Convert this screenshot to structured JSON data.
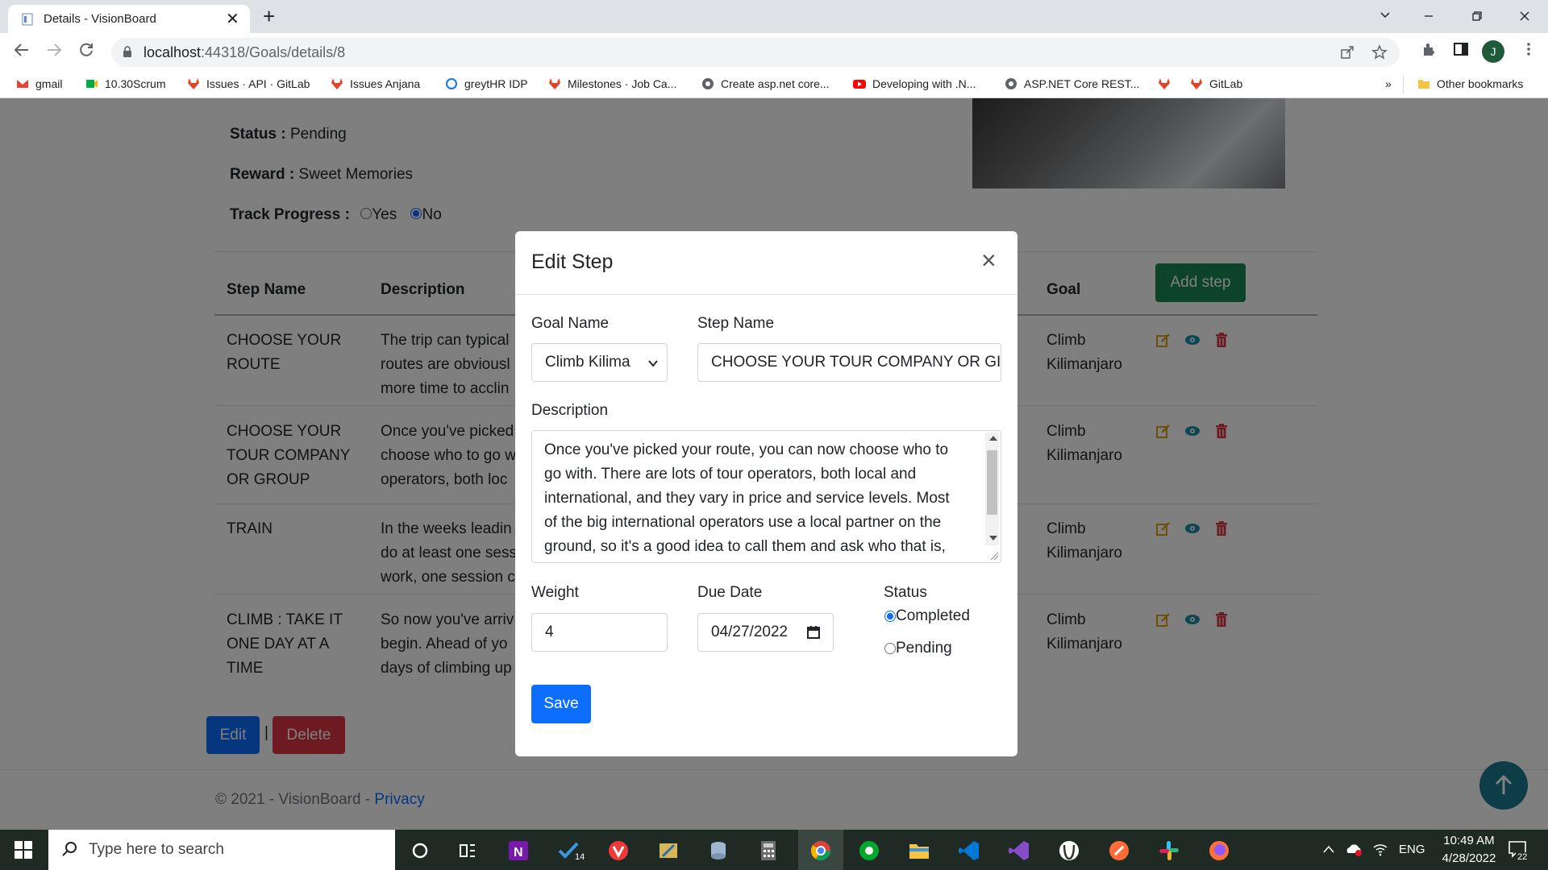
{
  "browser": {
    "tab_title": "Details - VisionBoard",
    "tab_close": "✕",
    "new_tab": "+",
    "url_host": "localhost",
    "url_rest": ":44318/Goals/details/8",
    "profile_initial": "J",
    "bookmarks": [
      "gmail",
      "10.30Scrum",
      "Issues · API · GitLab",
      "Issues Anjana",
      "greytHR IDP",
      "Milestones · Job Ca...",
      "Create asp.net core...",
      "Developing with .N...",
      "ASP.NET Core REST...",
      "",
      "GitLab"
    ],
    "bookmarks_more": "»",
    "other_bookmarks": "Other bookmarks"
  },
  "goal": {
    "status_label": "Status :",
    "status_value": "Pending",
    "reward_label": "Reward :",
    "reward_value": "Sweet Memories",
    "track_label": "Track Progress :",
    "track_yes": "Yes",
    "track_no": "No"
  },
  "table": {
    "headers": {
      "step_name": "Step Name",
      "description": "Description",
      "goal": "Goal"
    },
    "add_step": "Add step",
    "rows": [
      {
        "name": [
          "CHOOSE YOUR",
          "ROUTE"
        ],
        "desc": [
          "The trip can typical",
          "routes are obviousl",
          "more time to acclin"
        ],
        "goal": [
          "Climb",
          "Kilimanjaro"
        ]
      },
      {
        "name": [
          "CHOOSE YOUR",
          "TOUR COMPANY",
          "OR GROUP"
        ],
        "desc": [
          "Once you've picked",
          "choose who to go w",
          "operators, both loc"
        ],
        "goal": [
          "Climb",
          "Kilimanjaro"
        ]
      },
      {
        "name": [
          "TRAIN"
        ],
        "desc": [
          "In the weeks leadin",
          "do at least one sess",
          "work, one session c"
        ],
        "goal": [
          "Climb",
          "Kilimanjaro"
        ]
      },
      {
        "name": [
          "CLIMB : TAKE IT",
          "ONE DAY AT A",
          "TIME"
        ],
        "desc": [
          "So now you've arriv",
          "begin. Ahead of yo",
          "days of climbing up one of the world's highest..."
        ],
        "goal": [
          "Climb",
          "Kilimanjaro"
        ]
      }
    ]
  },
  "actions": {
    "edit": "Edit",
    "separator": "|",
    "delete": "Delete"
  },
  "footer": {
    "text": "© 2021 - VisionBoard - ",
    "privacy": "Privacy"
  },
  "modal": {
    "title": "Edit Step",
    "close": "×",
    "goal_name_label": "Goal Name",
    "goal_name_value": "Climb Kilima",
    "step_name_label": "Step Name",
    "step_name_value": "CHOOSE YOUR TOUR COMPANY OR GI",
    "description_label": "Description",
    "description_lines": [
      "Once you've picked your route, you can now choose who to",
      "go with. There are lots of tour operators, both local and",
      "international, and they vary in price and service levels. Most",
      "of the big international operators use a local partner on the",
      "ground, so it's a good idea to call them and ask who that is,"
    ],
    "weight_label": "Weight",
    "weight_value": "4",
    "due_date_label": "Due Date",
    "due_date_value": "04/27/2022",
    "status_label": "Status",
    "status_completed": "Completed",
    "status_pending": "Pending",
    "status_selected": "Completed",
    "save": "Save"
  },
  "taskbar": {
    "search_placeholder": "Type here to search",
    "badge": "14",
    "lang": "ENG",
    "time": "10:49 AM",
    "date": "4/28/2022",
    "notif_count": "22"
  },
  "colors": {
    "primary": "#0d6efd",
    "success": "#198754",
    "danger": "#dc3545",
    "edit_icon": "#d4a017",
    "view_icon": "#1b8fa8",
    "delete_icon": "#dc3545",
    "taskbar": "#1f2a24"
  }
}
